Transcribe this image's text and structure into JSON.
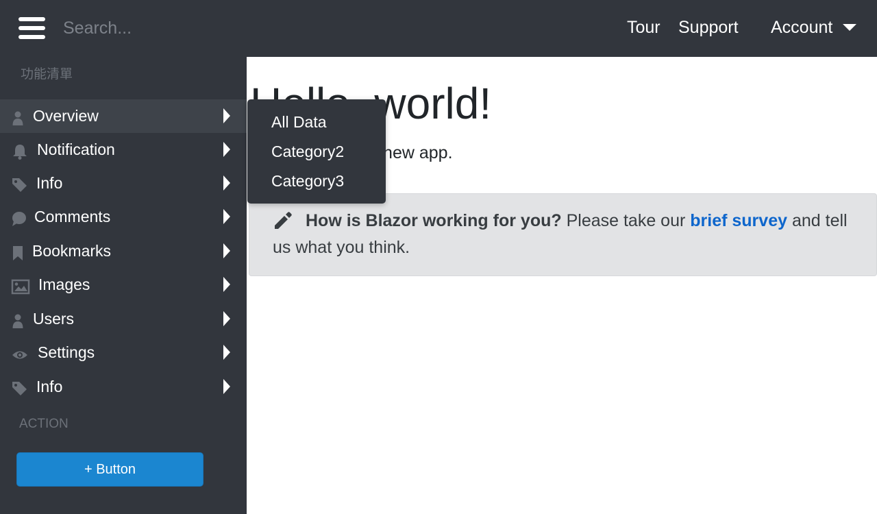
{
  "header": {
    "search_placeholder": "Search...",
    "links": {
      "tour": "Tour",
      "support": "Support",
      "account": "Account"
    }
  },
  "sidebar": {
    "section_features": "功能清單",
    "items": [
      {
        "label": "Overview",
        "icon": "user-icon"
      },
      {
        "label": "Notification",
        "icon": "bell-icon"
      },
      {
        "label": "Info",
        "icon": "tag-icon"
      },
      {
        "label": "Comments",
        "icon": "comment-icon"
      },
      {
        "label": "Bookmarks",
        "icon": "bookmark-icon"
      },
      {
        "label": "Images",
        "icon": "image-icon"
      },
      {
        "label": "Users",
        "icon": "user-icon"
      },
      {
        "label": "Settings",
        "icon": "eye-icon"
      },
      {
        "label": "Info",
        "icon": "tag-icon"
      }
    ],
    "section_action": "ACTION",
    "action_button": "+ Button"
  },
  "submenu": {
    "items": [
      "All Data",
      "Category2",
      "Category3"
    ]
  },
  "main": {
    "heading": "Hello, world!",
    "intro": "Welcome to your new app.",
    "survey": {
      "question": "How is Blazor working for you?",
      "text_before": " Please take our ",
      "link": "brief survey",
      "text_after": " and tell us what you think."
    }
  },
  "colors": {
    "sidebar_bg": "#32363d",
    "active_item_bg": "#3e434a",
    "accent_button": "#1b86d0",
    "link": "#0e66cc",
    "survey_bg": "#e2e3e5"
  }
}
